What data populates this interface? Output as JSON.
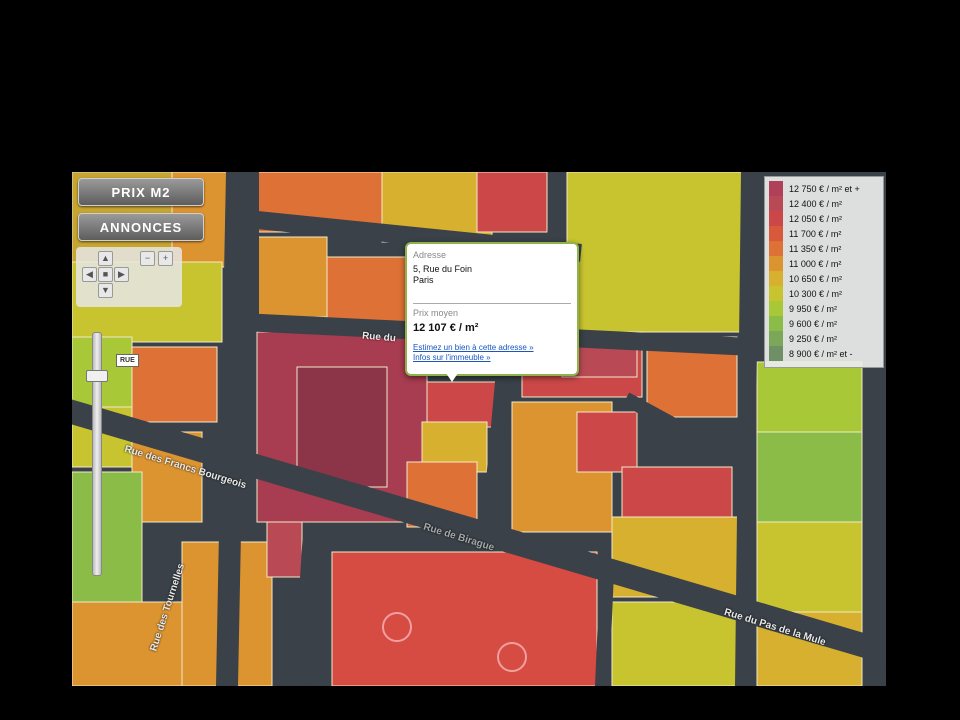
{
  "buttons": {
    "prix_m2": "PRIX M2",
    "annonces": "ANNONCES"
  },
  "map_controls": {
    "pan_up": "▲",
    "pan_down": "▼",
    "pan_left": "◀",
    "pan_right": "▶",
    "pan_center": "■",
    "zoom_in": "+",
    "zoom_out": "−",
    "badge": "RUE"
  },
  "legend": {
    "items": [
      {
        "label": "12 750 € / m² et +",
        "color": "#b0405a"
      },
      {
        "label": "12 400 € / m²",
        "color": "#b94a55"
      },
      {
        "label": "12 050 € / m²",
        "color": "#cc4848"
      },
      {
        "label": "11 700 € / m²",
        "color": "#d8583c"
      },
      {
        "label": "11 350 € / m²",
        "color": "#de7236"
      },
      {
        "label": "11 000 € / m²",
        "color": "#dc9430"
      },
      {
        "label": "10 650 € / m²",
        "color": "#d6b02e"
      },
      {
        "label": "10 300 € / m²",
        "color": "#c8c430"
      },
      {
        "label": "9 950 € / m²",
        "color": "#a8c838"
      },
      {
        "label": "9 600 € / m²",
        "color": "#8cbc48"
      },
      {
        "label": "9 250 € / m²",
        "color": "#7aa858"
      },
      {
        "label": "8 900 € / m² et -",
        "color": "#6e9064"
      }
    ]
  },
  "popup": {
    "address_label": "Adresse",
    "address_line1": "5, Rue du Foin",
    "address_line2": "Paris",
    "price_label": "Prix moyen",
    "price_value": "12 107 € / m²",
    "link1": "Estimez un bien à cette adresse »",
    "link2": "Infos sur l'immeuble »"
  },
  "streets": {
    "francs_bourgeois": "Rue des Francs Bourgeois",
    "tournelles": "Rue des Tournelles",
    "pas_de_la_mule": "Rue du Pas de la Mule",
    "birague": "Rue de Birague",
    "rue_du": "Rue du"
  },
  "colors": {
    "road": "#3a4148",
    "parcel_border": "#f4e8c8",
    "popup_border": "#8fb24a"
  }
}
